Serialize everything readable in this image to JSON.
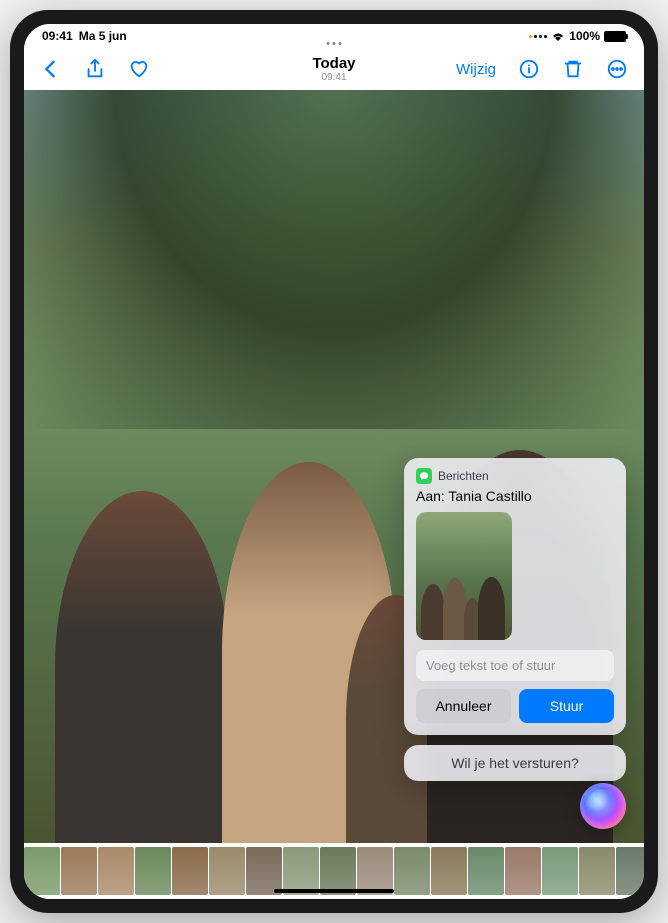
{
  "status_bar": {
    "time": "09:41",
    "date": "Ma 5 jun",
    "battery_percent": "100%"
  },
  "toolbar": {
    "title": "Today",
    "subtitle": "09:41",
    "edit_label": "Wijzig"
  },
  "siri_panel": {
    "app_name": "Berichten",
    "recipient": "Aan: Tania Castillo",
    "placeholder": "Voeg tekst toe of stuur",
    "cancel_label": "Annuleer",
    "send_label": "Stuur",
    "prompt": "Wil je het versturen?"
  },
  "thumbnails": [
    "#7a9a6a",
    "#9a7a5a",
    "#aa8a6a",
    "#6a8a5a",
    "#8a6a4a",
    "#9a8a6a",
    "#7a6a5a",
    "#8a9a7a",
    "#6a7a5a",
    "#9a8a7a",
    "#7a8a6a",
    "#8a7a5a",
    "#6a8a6a",
    "#9a7a6a",
    "#7a9a7a",
    "#8a8a6a",
    "#6a7a6a"
  ]
}
